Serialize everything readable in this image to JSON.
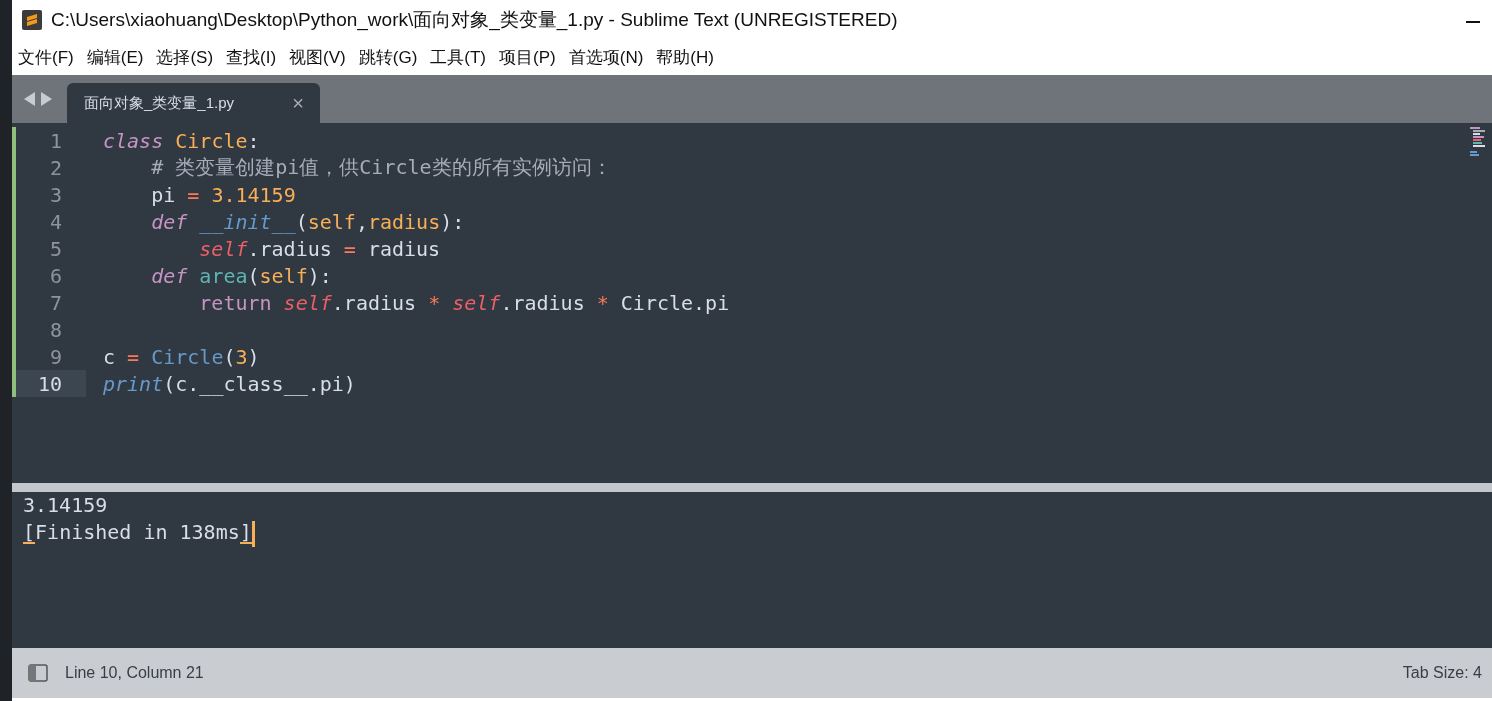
{
  "window": {
    "title": "C:\\Users\\xiaohuang\\Desktop\\Python_work\\面向对象_类变量_1.py - Sublime Text (UNREGISTERED)"
  },
  "menu": [
    "文件(F)",
    "编辑(E)",
    "选择(S)",
    "查找(I)",
    "视图(V)",
    "跳转(G)",
    "工具(T)",
    "项目(P)",
    "首选项(N)",
    "帮助(H)"
  ],
  "tabs": [
    {
      "label": "面向对象_类变量_1.py",
      "selected": true,
      "close": "×"
    }
  ],
  "editor": {
    "lines": [
      {
        "number": "1",
        "current": false,
        "modified": true,
        "tokens": [
          {
            "kind": "keyword",
            "text": "class"
          },
          {
            "kind": "classname",
            "text": " Circle"
          },
          {
            "kind": "plain",
            "text": ":"
          }
        ]
      },
      {
        "number": "2",
        "current": false,
        "modified": true,
        "tokens": [
          {
            "kind": "comment",
            "text": "    # 类变量创建pi值，供Circle类的所有实例访问："
          }
        ]
      },
      {
        "number": "3",
        "current": false,
        "modified": true,
        "tokens": [
          {
            "kind": "plain",
            "text": "    pi "
          },
          {
            "kind": "operator",
            "text": "="
          },
          {
            "kind": "number",
            "text": " 3.14159"
          }
        ]
      },
      {
        "number": "4",
        "current": false,
        "modified": true,
        "tokens": [
          {
            "kind": "keyword",
            "text": "    def"
          },
          {
            "kind": "function",
            "text": " __init__"
          },
          {
            "kind": "plain",
            "text": "("
          },
          {
            "kind": "param",
            "text": "self"
          },
          {
            "kind": "plain",
            "text": ","
          },
          {
            "kind": "param",
            "text": "radius"
          },
          {
            "kind": "plain",
            "text": "):"
          }
        ]
      },
      {
        "number": "5",
        "current": false,
        "modified": true,
        "tokens": [
          {
            "kind": "self",
            "text": "        self"
          },
          {
            "kind": "plain",
            "text": ".radius "
          },
          {
            "kind": "operator",
            "text": "="
          },
          {
            "kind": "plain",
            "text": " radius"
          }
        ]
      },
      {
        "number": "6",
        "current": false,
        "modified": true,
        "tokens": [
          {
            "kind": "keyword",
            "text": "    def"
          },
          {
            "kind": "name",
            "text": " area"
          },
          {
            "kind": "plain",
            "text": "("
          },
          {
            "kind": "param",
            "text": "self"
          },
          {
            "kind": "plain",
            "text": "):"
          }
        ]
      },
      {
        "number": "7",
        "current": false,
        "modified": true,
        "tokens": [
          {
            "kind": "return",
            "text": "        return"
          },
          {
            "kind": "self",
            "text": " self"
          },
          {
            "kind": "plain",
            "text": ".radius "
          },
          {
            "kind": "operator",
            "text": "*"
          },
          {
            "kind": "self",
            "text": " self"
          },
          {
            "kind": "plain",
            "text": ".radius "
          },
          {
            "kind": "operator",
            "text": "*"
          },
          {
            "kind": "plain",
            "text": " Circle.pi"
          }
        ]
      },
      {
        "number": "8",
        "current": false,
        "modified": true
      },
      {
        "number": "9",
        "current": false,
        "modified": true,
        "tokens": [
          {
            "kind": "plain",
            "text": "c "
          },
          {
            "kind": "operator",
            "text": "="
          },
          {
            "kind": "call",
            "text": " Circle"
          },
          {
            "kind": "plain",
            "text": "("
          },
          {
            "kind": "number",
            "text": "3"
          },
          {
            "kind": "plain",
            "text": ")"
          }
        ]
      },
      {
        "number": "10",
        "current": true,
        "modified": true,
        "tokens": [
          {
            "kind": "builtin",
            "text": "print"
          },
          {
            "kind": "plain",
            "text": "(c.__class__.pi)"
          }
        ]
      }
    ]
  },
  "output": {
    "lines": [
      {
        "text": "3.14159",
        "brackets": false
      },
      {
        "text": "[Finished in 138ms]",
        "brackets": true
      }
    ]
  },
  "status_bar": {
    "position": "Line 10, Column 21",
    "tab_size": "Tab Size: 4"
  }
}
